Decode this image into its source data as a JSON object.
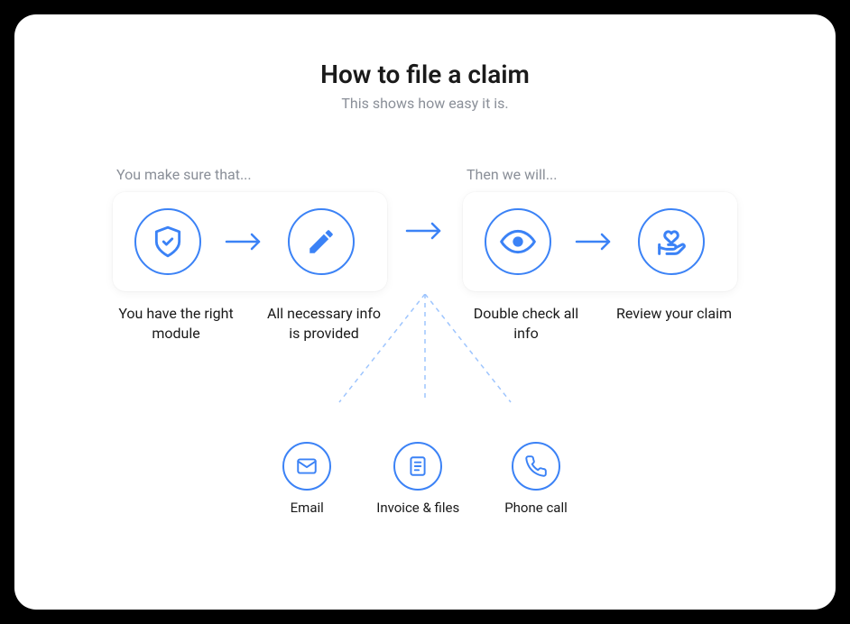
{
  "header": {
    "title": "How to file a claim",
    "subtitle": "This shows how easy it is."
  },
  "groups": {
    "user": {
      "label": "You make sure that...",
      "steps": [
        {
          "icon": "shield-check",
          "label": "You have the right module"
        },
        {
          "icon": "pencil",
          "label": "All necessary info is provided"
        }
      ]
    },
    "company": {
      "label": "Then we will...",
      "steps": [
        {
          "icon": "eye",
          "label": "Double check all info"
        },
        {
          "icon": "hand-heart",
          "label": "Review your claim"
        }
      ]
    }
  },
  "channels": [
    {
      "icon": "mail",
      "label": "Email"
    },
    {
      "icon": "file-text",
      "label": "Invoice & files"
    },
    {
      "icon": "phone",
      "label": "Phone call"
    }
  ],
  "colors": {
    "accent": "#3b82f6",
    "text_muted": "#8a8f98",
    "text": "#1a1a1a"
  }
}
